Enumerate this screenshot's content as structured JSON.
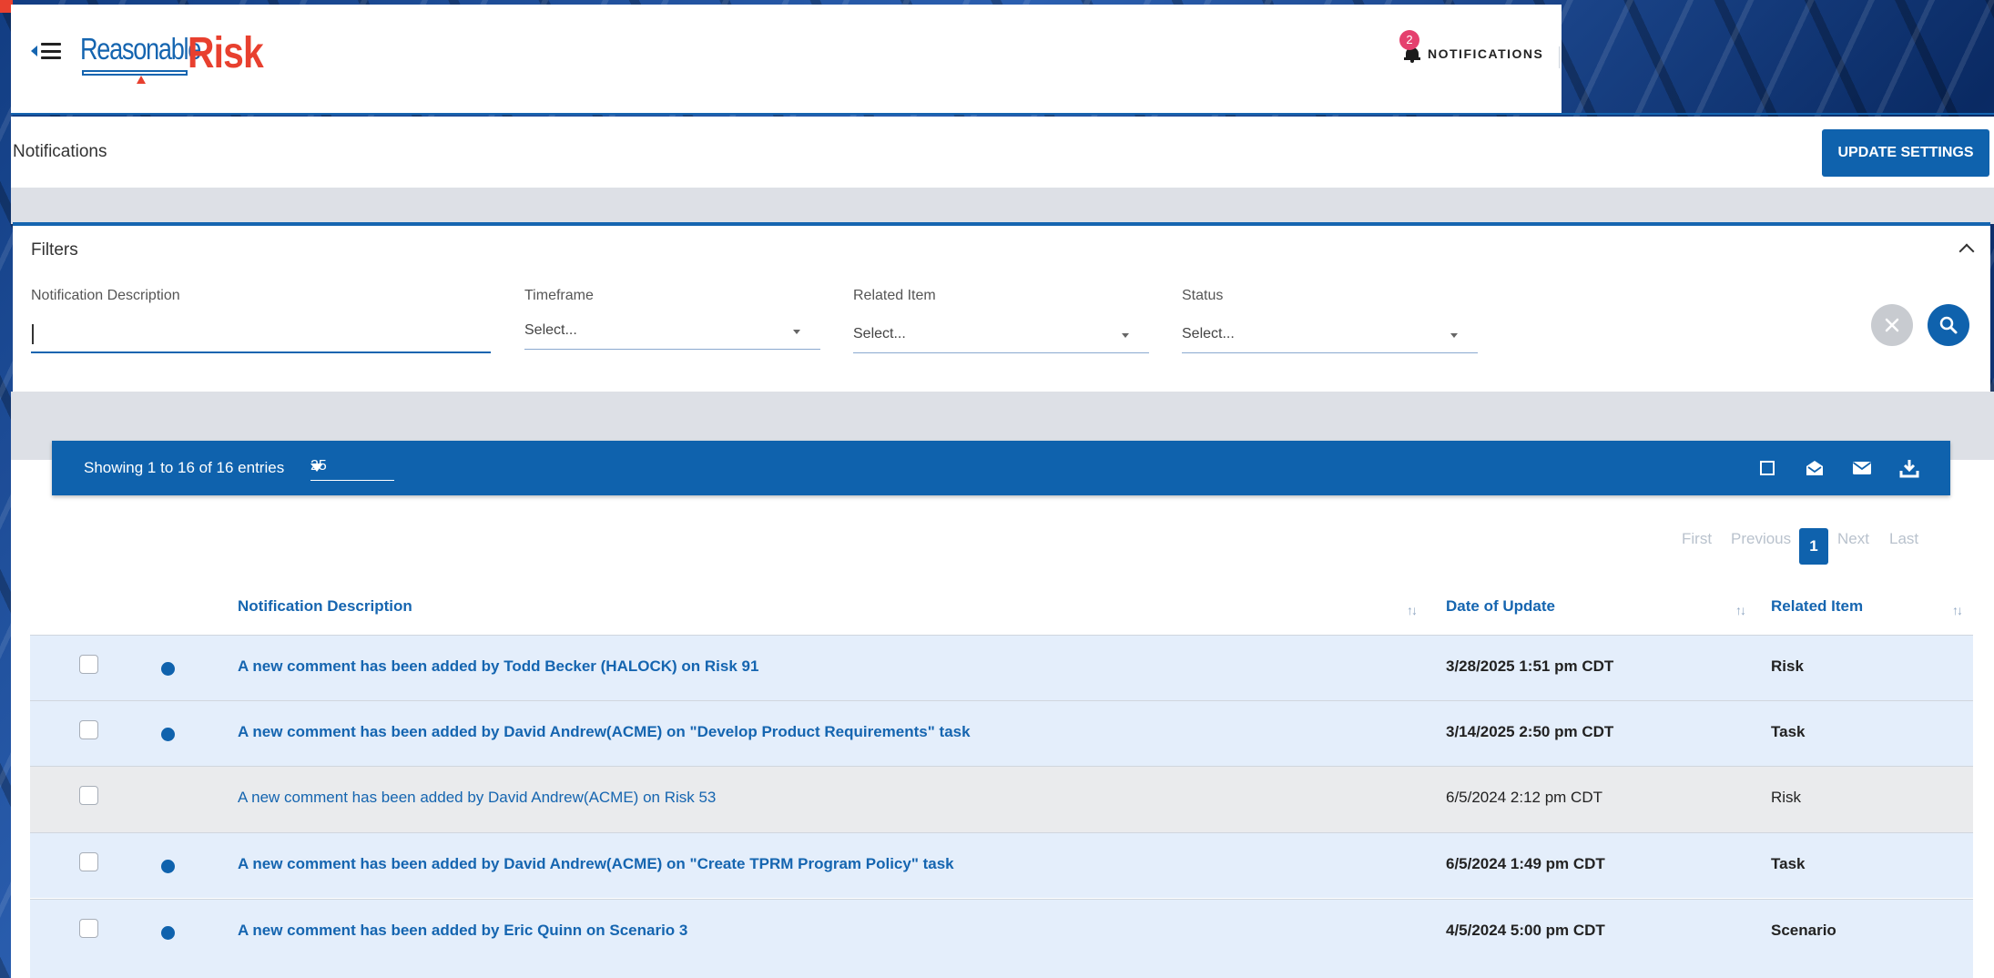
{
  "topbar": {
    "logo_left": "Reasonable",
    "logo_right": "Risk",
    "notifications_count": "2",
    "notifications_label": "NOTIFICATIONS"
  },
  "page": {
    "title": "Notifications",
    "update_settings_label": "UPDATE SETTINGS"
  },
  "filters": {
    "title": "Filters",
    "description_label": "Notification Description",
    "description_value": "",
    "timeframe_label": "Timeframe",
    "timeframe_value": "Select...",
    "related_label": "Related Item",
    "related_value": "Select...",
    "status_label": "Status",
    "status_value": "Select..."
  },
  "table": {
    "showing_text": "Showing 1 to 16 of 16 entries",
    "page_size": "25",
    "pager": {
      "first": "First",
      "previous": "Previous",
      "current": "1",
      "next": "Next",
      "last": "Last"
    },
    "columns": [
      "Notification Description",
      "Date of Update",
      "Related Item"
    ],
    "rows": [
      {
        "description": "A new comment has been added by Todd Becker (HALOCK) on Risk 91",
        "date": "3/28/2025 1:51 pm CDT",
        "related": "Risk",
        "unread": true
      },
      {
        "description": "A new comment has been added by David Andrew(ACME) on \"Develop Product Requirements\" task",
        "date": "3/14/2025 2:50 pm CDT",
        "related": "Task",
        "unread": true
      },
      {
        "description": "A new comment has been added by David Andrew(ACME) on Risk 53",
        "date": "6/5/2024 2:12 pm CDT",
        "related": "Risk",
        "unread": false
      },
      {
        "description": "A new comment has been added by David Andrew(ACME) on \"Create TPRM Program Policy\" task",
        "date": "6/5/2024 1:49 pm CDT",
        "related": "Task",
        "unread": true
      },
      {
        "description": "A new comment has been added by Eric Quinn on Scenario 3",
        "date": "4/5/2024 5:00 pm CDT",
        "related": "Scenario",
        "unread": true
      }
    ]
  },
  "colors": {
    "primary": "#0f62ad",
    "brand_red": "#e8402f",
    "badge": "#e5406e",
    "unread_row": "#e4eefb",
    "read_row": "#eaebed"
  },
  "icons": [
    "back-triangle-icon",
    "hamburger-icon",
    "bell-icon",
    "chevron-up-icon",
    "clear-icon",
    "search-icon",
    "select-all-checkbox-icon",
    "mark-read-icon",
    "mark-unread-icon",
    "download-icon",
    "sort-icon"
  ]
}
